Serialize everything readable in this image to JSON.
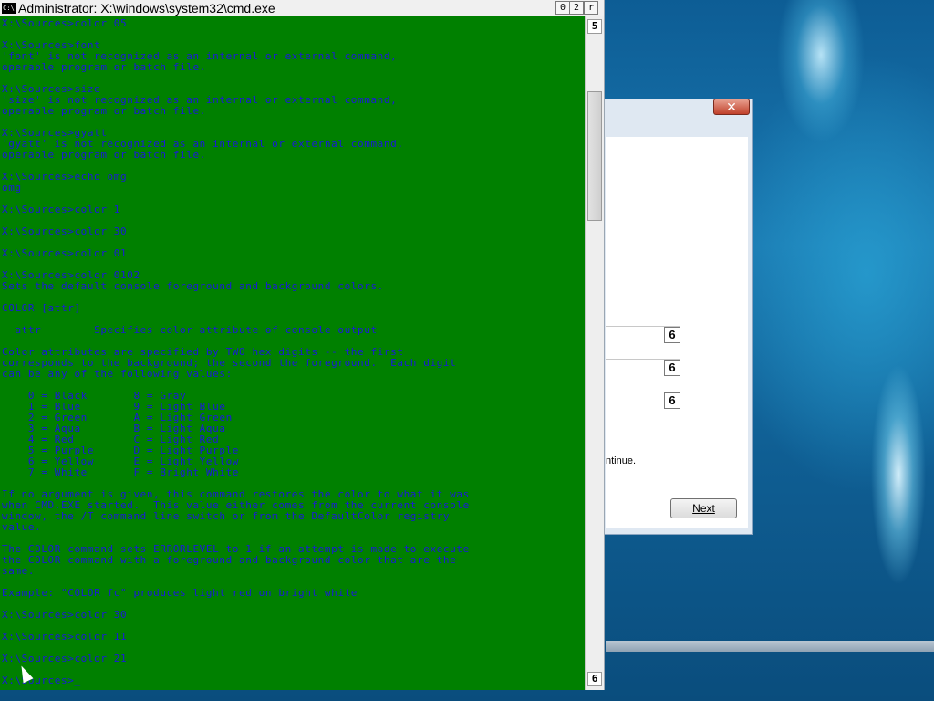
{
  "cmd_window": {
    "title": "Administrator: X:\\windows\\system32\\cmd.exe",
    "icon": "C:\\",
    "buttons": {
      "minimize": "0",
      "maximize": "2",
      "close": "r"
    },
    "scroll_up": "5",
    "scroll_down": "6",
    "console_lines": [
      "X:\\Sources>color 05",
      "",
      "X:\\Sources>font",
      "'font' is not recognized as an internal or external command,",
      "operable program or batch file.",
      "",
      "X:\\Sources>size",
      "'size' is not recognized as an internal or external command,",
      "operable program or batch file.",
      "",
      "X:\\Sources>gyatt",
      "'gyatt' is not recognized as an internal or external command,",
      "operable program or batch file.",
      "",
      "X:\\Sources>echo omg",
      "omg",
      "",
      "X:\\Sources>color 1",
      "",
      "X:\\Sources>color 30",
      "",
      "X:\\Sources>color 01",
      "",
      "X:\\Sources>color 0102",
      "Sets the default console foreground and background colors.",
      "",
      "COLOR [attr]",
      "",
      "  attr        Specifies color attribute of console output",
      "",
      "Color attributes are specified by TWO hex digits -- the first",
      "corresponds to the background; the second the foreground.  Each digit",
      "can be any of the following values:",
      "",
      "    0 = Black       8 = Gray",
      "    1 = Blue        9 = Light Blue",
      "    2 = Green       A = Light Green",
      "    3 = Aqua        B = Light Aqua",
      "    4 = Red         C = Light Red",
      "    5 = Purple      D = Light Purple",
      "    6 = Yellow      E = Light Yellow",
      "    7 = White       F = Bright White",
      "",
      "If no argument is given, this command restores the color to what it was",
      "when CMD.EXE started.  This value either comes from the current console",
      "window, the /T command line switch or from the DefaultColor registry",
      "value.",
      "",
      "The COLOR command sets ERRORLEVEL to 1 if an attempt is made to execute",
      "the COLOR command with a foreground and background color that are the",
      "same.",
      "",
      "Example: \"COLOR fc\" produces light red on bright white",
      "",
      "X:\\Sources>color 30",
      "",
      "X:\\Sources>color 11",
      "",
      "X:\\Sources>color 21",
      "",
      "X:\\Sources>_"
    ],
    "colors": {
      "console_bg": "#008000",
      "console_fg": "#1a1ad8"
    }
  },
  "setup_dialog": {
    "close_glyph": "✕",
    "spinners": [
      "6",
      "6",
      "6"
    ],
    "continue_text": "ntinue.",
    "next_button": "Next"
  },
  "icons": {
    "cmd": "cmd-icon",
    "close": "close-icon",
    "scroll_up": "scroll-up-icon",
    "scroll_down": "scroll-down-icon",
    "cursor": "mouse-pointer-icon"
  }
}
